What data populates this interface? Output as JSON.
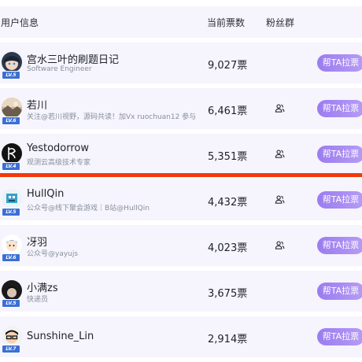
{
  "header": {
    "user_col": "用户信息",
    "votes_col": "当前票数",
    "fans_col": "粉丝群"
  },
  "colors": {
    "row_bg": "#f6f4fc",
    "button_gradient": [
      "#9b7cf0",
      "#b69cf5"
    ],
    "level_badge": "#3b6fd6",
    "highlight_line": "#f2380c"
  },
  "rows": [
    {
      "name": "宫水三叶的刷题日记",
      "desc": "Software Engineer",
      "level": "LV.5",
      "votes": "9,027票",
      "fan_group": false,
      "button": "帮TA拉票",
      "avatar": "anime-avatar"
    },
    {
      "name": "若川",
      "desc": "关注@若川视野，源码共读！加Vx ruochuan12 参与",
      "level": "LV.6",
      "votes": "6,461票",
      "fan_group": true,
      "button": "帮TA拉票",
      "avatar": "landscape-avatar"
    },
    {
      "name": "Yestodorrow",
      "desc": "观测云高级技术专家",
      "level": "LV.4",
      "votes": "5,351票",
      "fan_group": true,
      "button": "帮TA拉票",
      "avatar": "dark-logo-avatar"
    },
    {
      "name": "HullQin",
      "desc": "公众号@线下聚会游戏｜B站@HullQin",
      "level": "LV.5",
      "votes": "4,432票",
      "fan_group": true,
      "button": "帮TA拉票",
      "avatar": "pixel-avatar"
    },
    {
      "name": "冴羽",
      "desc": "公众号@yayujs",
      "level": "LV.6",
      "votes": "4,023票",
      "fan_group": true,
      "button": "帮TA拉票",
      "avatar": "cartoon-avatar"
    },
    {
      "name": "小满zs",
      "desc": "快递员",
      "level": "LV.5",
      "votes": "3,675票",
      "fan_group": false,
      "button": "帮TA拉票",
      "avatar": "dark-anime-avatar"
    },
    {
      "name": "Sunshine_Lin",
      "desc": "",
      "level": "LV.7",
      "votes": "2,914票",
      "fan_group": false,
      "button": "帮TA拉票",
      "avatar": "glasses-avatar"
    }
  ]
}
